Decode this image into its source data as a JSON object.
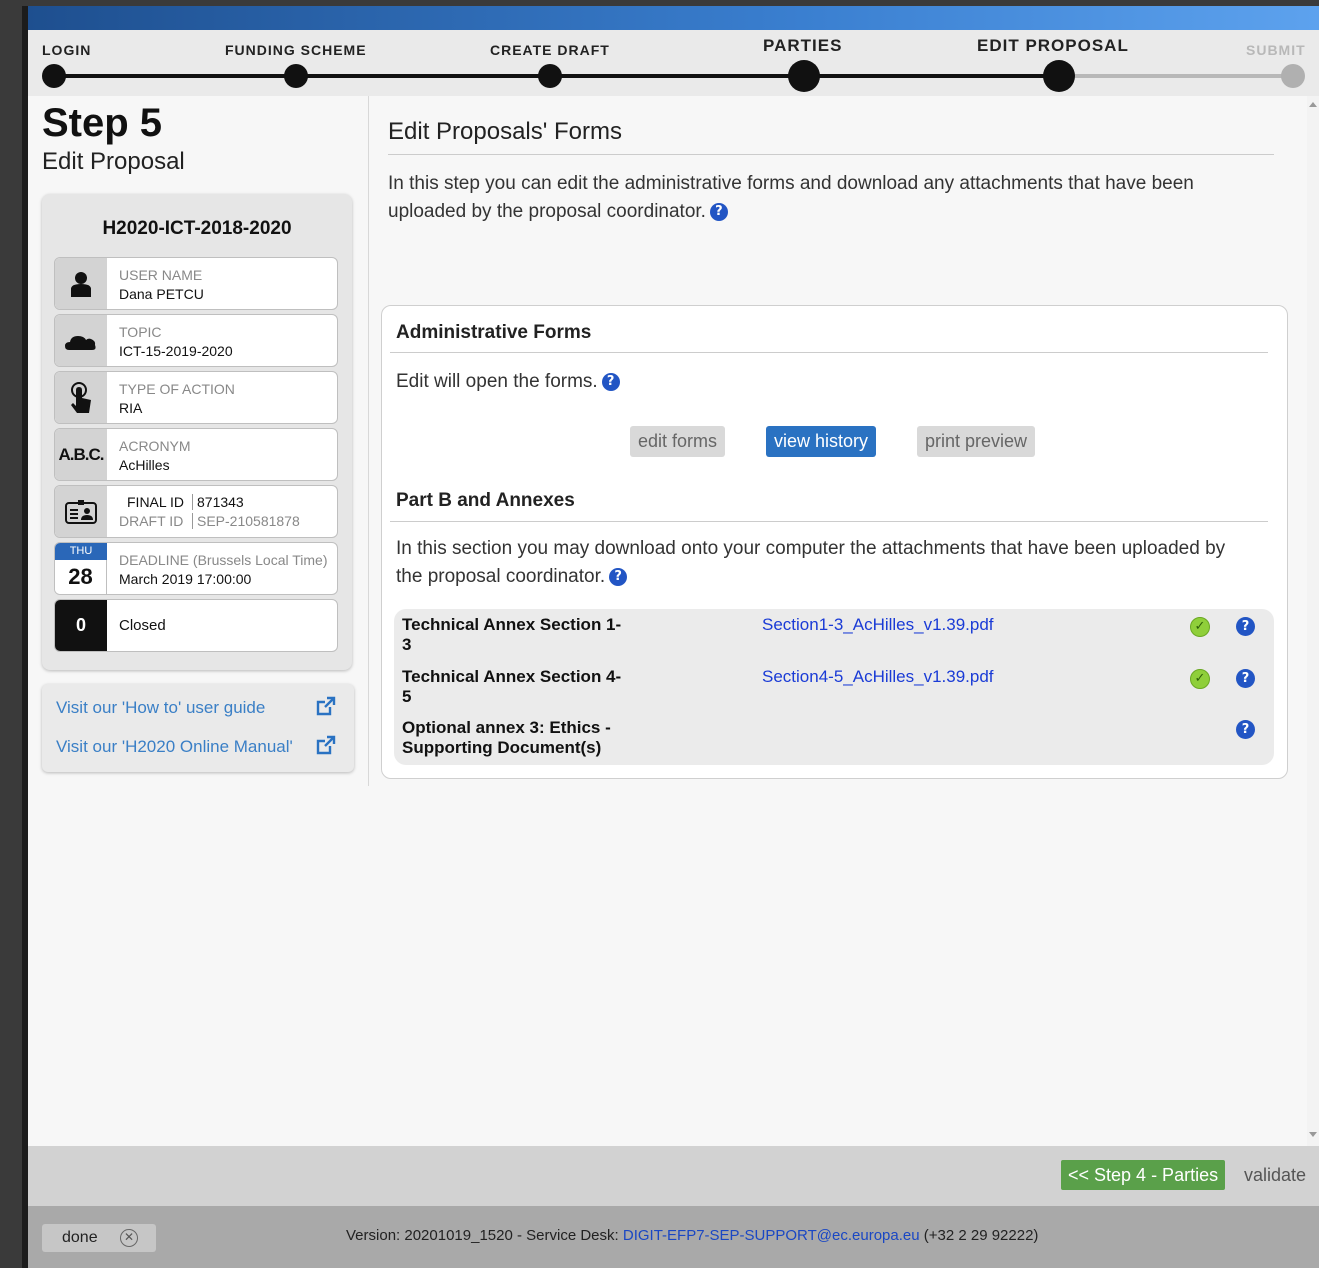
{
  "steps": [
    {
      "label": "LOGIN",
      "state": "done"
    },
    {
      "label": "FUNDING SCHEME",
      "state": "done"
    },
    {
      "label": "CREATE DRAFT",
      "state": "done"
    },
    {
      "label": "PARTIES",
      "state": "done"
    },
    {
      "label": "EDIT PROPOSAL",
      "state": "current"
    },
    {
      "label": "SUBMIT",
      "state": "disabled"
    }
  ],
  "left": {
    "step_title": "Step 5",
    "step_subtitle": "Edit Proposal",
    "call_id": "H2020-ICT-2018-2020",
    "user_label": "USER NAME",
    "user_value": "Dana PETCU",
    "topic_label": "TOPIC",
    "topic_value": "ICT-15-2019-2020",
    "action_label": "TYPE OF ACTION",
    "action_value": "RIA",
    "acronym_icon_text": "A.B.C.",
    "acronym_label": "ACRONYM",
    "acronym_value": "AcHilles",
    "final_id_label": "FINAL ID",
    "final_id_value": "871343",
    "draft_id_label": "DRAFT ID",
    "draft_id_value": "SEP-210581878",
    "deadline_day": "THU",
    "deadline_date": "28",
    "deadline_label": "DEADLINE (Brussels Local Time)",
    "deadline_value": "March 2019 17:00:00",
    "status_count": "0",
    "status_value": "Closed",
    "link_guide": "Visit our 'How to' user guide",
    "link_manual": "Visit our 'H2020 Online Manual'"
  },
  "main": {
    "title": "Edit Proposals' Forms",
    "intro": "In this step you can edit the administrative forms and download any attachments that have been uploaded by the proposal coordinator.",
    "admin_heading": "Administrative Forms",
    "admin_text": "Edit will open the forms.",
    "btn_edit": "edit forms",
    "btn_history": "view history",
    "btn_print": "print preview",
    "partb_heading": "Part B and Annexes",
    "partb_text": "In this section you may download onto your computer the attachments that have been uploaded by the proposal coordinator.",
    "attachments": [
      {
        "name": "Technical Annex Section 1-3",
        "file": "Section1-3_AcHilles_v1.39.pdf",
        "ok": true
      },
      {
        "name": "Technical Annex Section 4-5",
        "file": "Section4-5_AcHilles_v1.39.pdf",
        "ok": true
      },
      {
        "name": "Optional annex 3: Ethics - Supporting Document(s)",
        "file": "",
        "ok": false
      }
    ]
  },
  "footer": {
    "prev_label": "<< Step 4 - Parties",
    "validate_label": "validate",
    "done_label": "done",
    "version_prefix": "Version: 20201019_1520 - Service Desk:",
    "support_email": "DIGIT-EFP7-SEP-SUPPORT@ec.europa.eu",
    "phone": "(+32 2 29 92222)"
  },
  "colors": {
    "accent": "#2a72c2",
    "success": "#5aa04a",
    "link": "#1a3bd6"
  }
}
